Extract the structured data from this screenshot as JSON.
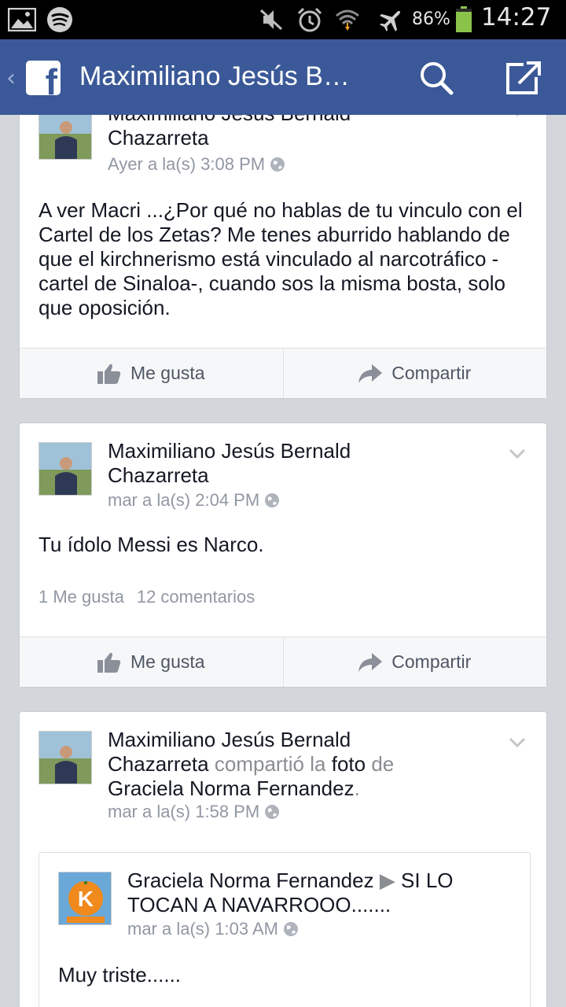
{
  "status_bar": {
    "battery": "86%",
    "time": "14:27",
    "icons": [
      "gallery-icon",
      "spotify-icon",
      "mute-icon",
      "alarm-icon",
      "wifi-icon",
      "airplane-icon",
      "battery-icon"
    ]
  },
  "app_bar": {
    "back": "‹",
    "logo": "f",
    "title": "Maximiliano Jesús B…",
    "icons": [
      "search-icon",
      "compose-icon"
    ]
  },
  "posts": [
    {
      "author_line1": "Maximiliano Jesús Bernald",
      "author_line2": "Chazarreta",
      "time": "Ayer a la(s) 3:08 PM",
      "text": "A ver Macri ...¿Por qué no hablas de tu vinculo con el Cartel de los Zetas? Me tenes aburrido hablando de que el kirchnerismo está vinculado al narcotráfico -cartel de Sinaloa-, cuando sos la misma bosta, solo que oposición.",
      "like_label": "Me gusta",
      "share_label": "Compartir"
    },
    {
      "author_line1": "Maximiliano Jesús Bernald",
      "author_line2": "Chazarreta",
      "time": "mar a la(s) 2:04 PM",
      "text": "Tu ídolo Messi es Narco.",
      "likes": "1 Me gusta",
      "comments": "12 comentarios",
      "like_label": "Me gusta",
      "share_label": "Compartir"
    },
    {
      "author_line1": "Maximiliano Jesús Bernald",
      "author_line2": "Chazarreta",
      "shared_verb": "compartió",
      "shared_la": "la",
      "shared_object": "foto",
      "shared_de": "de",
      "shared_owner": "Graciela Norma Fernandez",
      "shared_period": ".",
      "time": "mar a la(s) 1:58 PM",
      "shared": {
        "author": "Graciela Norma Fernandez",
        "arrow": "▶",
        "target": "SI LO TOCAN A NAVARROOO.......",
        "avatar_letter": "K",
        "time": "mar a la(s) 1:03 AM",
        "text": "Muy triste......"
      }
    }
  ],
  "colors": {
    "brand": "#3b5998",
    "feed_bg": "#d3d6db",
    "text": "#141823",
    "muted": "#9197a3"
  }
}
